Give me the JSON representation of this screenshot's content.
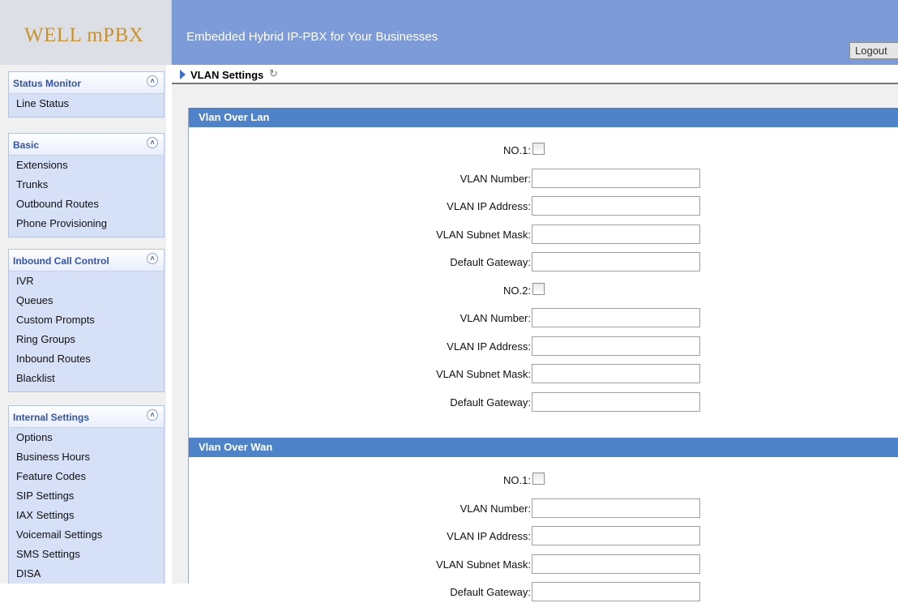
{
  "header": {
    "logo": "WELL mPBX",
    "tagline": "Embedded Hybrid IP-PBX for Your Businesses",
    "logout_label": "Logout"
  },
  "sidebar": {
    "collapse_icon": "double-chevron-up-icon",
    "groups": [
      {
        "title": "Status Monitor",
        "items": [
          "Line Status"
        ]
      },
      {
        "title": "Basic",
        "items": [
          "Extensions",
          "Trunks",
          "Outbound Routes",
          "Phone Provisioning"
        ]
      },
      {
        "title": "Inbound Call Control",
        "items": [
          "IVR",
          "Queues",
          "Custom Prompts",
          "Ring Groups",
          "Inbound Routes",
          "Blacklist"
        ]
      },
      {
        "title": "Internal Settings",
        "items": [
          "Options",
          "Business Hours",
          "Feature Codes",
          "SIP Settings",
          "IAX Settings",
          "Voicemail Settings",
          "SMS Settings",
          "DISA"
        ]
      }
    ]
  },
  "page": {
    "title": "VLAN Settings",
    "refresh_icon": "refresh-icon"
  },
  "sections": [
    {
      "title": "Vlan Over Lan",
      "rows": [
        {
          "label": "NO.1:",
          "type": "checkbox"
        },
        {
          "label": "VLAN Number:",
          "type": "text",
          "value": ""
        },
        {
          "label": "VLAN IP Address:",
          "type": "text",
          "value": ""
        },
        {
          "label": "VLAN Subnet Mask:",
          "type": "text",
          "value": ""
        },
        {
          "label": "Default Gateway:",
          "type": "text",
          "value": ""
        },
        {
          "label": "NO.2:",
          "type": "checkbox"
        },
        {
          "label": "VLAN Number:",
          "type": "text",
          "value": ""
        },
        {
          "label": "VLAN IP Address:",
          "type": "text",
          "value": ""
        },
        {
          "label": "VLAN Subnet Mask:",
          "type": "text",
          "value": ""
        },
        {
          "label": "Default Gateway:",
          "type": "text",
          "value": ""
        }
      ]
    },
    {
      "title": "Vlan Over Wan",
      "rows": [
        {
          "label": "NO.1:",
          "type": "checkbox"
        },
        {
          "label": "VLAN Number:",
          "type": "text",
          "value": ""
        },
        {
          "label": "VLAN IP Address:",
          "type": "text",
          "value": ""
        },
        {
          "label": "VLAN Subnet Mask:",
          "type": "text",
          "value": ""
        },
        {
          "label": "Default Gateway:",
          "type": "text",
          "value": ""
        }
      ]
    }
  ],
  "colors": {
    "header_band": "#7d9ad9",
    "section_header": "#4f83c9",
    "sidebar_group_title": "#3254b3",
    "logo": "#c8932e"
  }
}
